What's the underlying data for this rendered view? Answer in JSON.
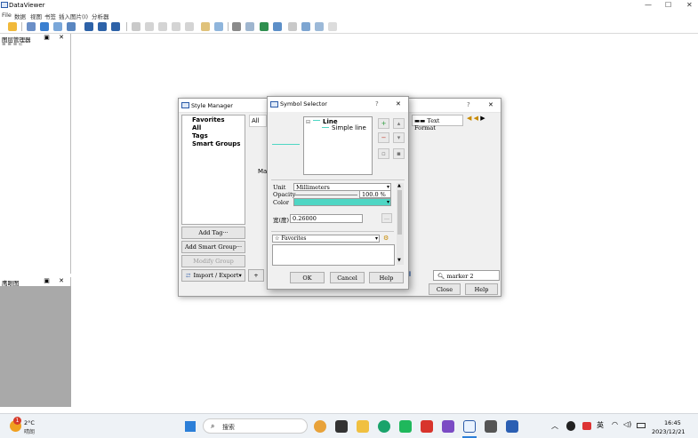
{
  "app": {
    "title": "DataViewer",
    "window_controls": {
      "minimize": "—",
      "maximize": "☐",
      "close": "✕"
    }
  },
  "menu": [
    "File",
    "数据",
    "视图",
    "书签",
    "插入图片(I)",
    "分析器"
  ],
  "left_panel_top": {
    "title": "图层管理器",
    "float": "▣",
    "close": "✕",
    "mini": "≡ ≡ ≡ ⊏"
  },
  "left_panel_bottom": {
    "title": "鹰眼图",
    "float": "▣",
    "close": "✕"
  },
  "style_manager": {
    "title": "Style Manager",
    "help": "?",
    "close": "✕",
    "list": [
      "Favorites",
      "All",
      "Tags",
      "Smart Groups"
    ],
    "tab_all": "All",
    "partial_text": "Ma",
    "text_format": "Text Format",
    "buttons": {
      "add_tag": "Add Tag···",
      "add_smart_group": "Add Smart Group···",
      "modify_group": "Modify Group",
      "import_export": "Import / Export▾",
      "close": "Close",
      "help": "Help"
    },
    "search_value": "marker 2",
    "plus": "+"
  },
  "symbol_selector": {
    "title": "Symbol Selector",
    "help": "?",
    "close": "✕",
    "tree": {
      "root": "Line",
      "child": "Simple line"
    },
    "unit_label": "Unit",
    "unit_value": "Millimeters",
    "opacity_label": "Opacity",
    "opacity_value": "100.0 %",
    "color_label": "Color",
    "color_hex": "#4fd6c4",
    "width_label": "宽(度)",
    "width_value": "0.26000",
    "favorites": "Favorites",
    "buttons": {
      "ok": "OK",
      "cancel": "Cancel",
      "help": "Help"
    }
  },
  "taskbar": {
    "weather_temp": "2°C",
    "weather_desc": "晴朗",
    "badge": "1",
    "search_placeholder": "搜索",
    "ime": "英",
    "time": "16:45",
    "date": "2023/12/21"
  }
}
